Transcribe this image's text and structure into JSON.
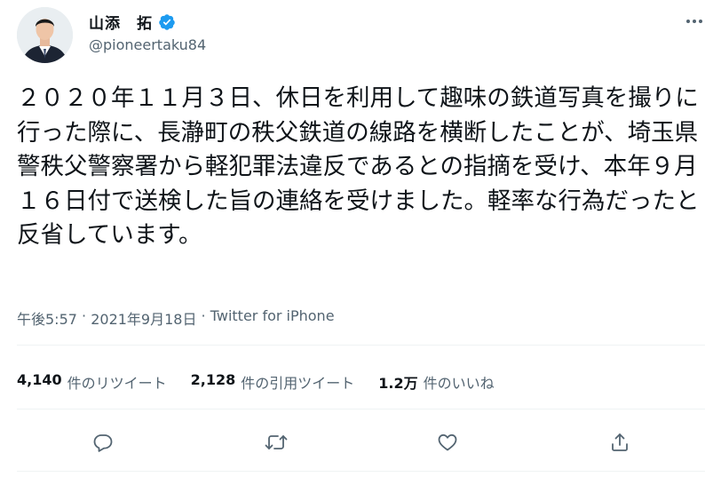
{
  "author": {
    "name": "山添　拓",
    "handle": "@pioneertaku84",
    "verified": true
  },
  "tweet": {
    "text": "２０２０年１１月３日、休日を利用して趣味の鉄道写真を撮りに行った際に、長瀞町の秩父鉄道の線路を横断したことが、埼玉県警秩父警察署から軽犯罪法違反であるとの指摘を受け、本年９月１６日付で送検した旨の連絡を受けました。軽率な行為だったと反省しています。"
  },
  "meta": {
    "time": "午後5:57",
    "separator1": " · ",
    "date": "2021年9月18日",
    "separator2": " · ",
    "source": "Twitter for iPhone"
  },
  "stats": {
    "retweets": {
      "count": "4,140",
      "label": "件のリツイート"
    },
    "quotes": {
      "count": "2,128",
      "label": "件の引用ツイート"
    },
    "likes": {
      "count": "1.2万",
      "label": "件のいいね"
    }
  },
  "icons": {
    "more": "more-dots-icon",
    "reply": "reply-icon",
    "retweet": "retweet-icon",
    "like": "heart-icon",
    "share": "share-icon",
    "verified": "verified-badge-icon"
  },
  "colors": {
    "text": "#0f1419",
    "secondary": "#536471",
    "verified": "#1d9bf0",
    "divider": "#eff3f4"
  }
}
